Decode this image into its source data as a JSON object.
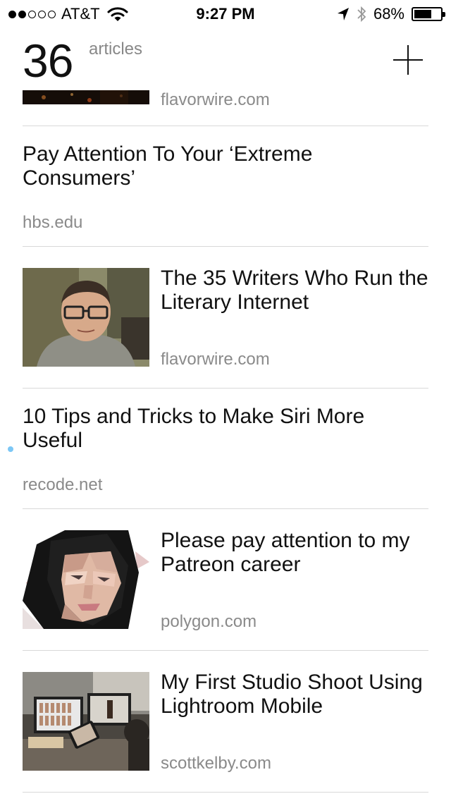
{
  "status_bar": {
    "carrier": "AT&T",
    "time": "9:27 PM",
    "battery": "68%",
    "battery_level": 0.68,
    "signal_bars_filled": 2,
    "signal_bars_total": 5
  },
  "header": {
    "count": "36",
    "count_label": "articles"
  },
  "articles": [
    {
      "title": "",
      "source": "flavorwire.com",
      "thumbnail": "dark-partial-image"
    },
    {
      "title": "Pay Attention To Your ‘Extreme Consumers’",
      "source": "hbs.edu"
    },
    {
      "title": "The 35 Writers Who Run the Literary Internet",
      "source": "flavorwire.com",
      "thumbnail": "man-with-glasses-photo"
    },
    {
      "title": "10 Tips and Tricks to Make Siri More Useful",
      "source": "recode.net",
      "unread": true
    },
    {
      "title": "Please pay attention to my Patreon career",
      "source": "polygon.com",
      "thumbnail": "low-poly-portrait"
    },
    {
      "title": "My First Studio Shoot Using Lightroom Mobile",
      "source": "scottkelby.com",
      "thumbnail": "studio-photo"
    }
  ],
  "colors": {
    "accent_unread": "#7cc7f5",
    "divider": "#d8d8d8",
    "secondary_text": "#8a8a8a"
  }
}
